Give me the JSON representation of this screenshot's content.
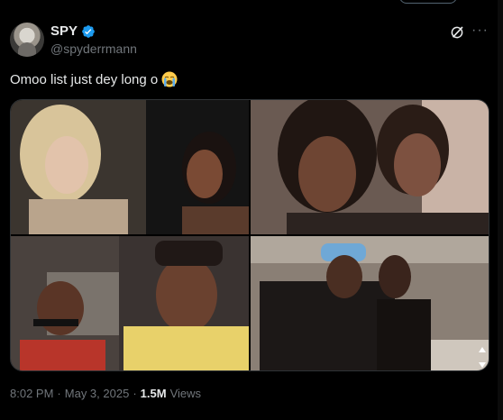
{
  "author": {
    "display_name": "SPY",
    "handle": "@spyderrmann",
    "verified_icon": "verified-badge-icon",
    "avatar_icon": "avatar-image"
  },
  "tweet": {
    "text": "Omoo list just dey long o",
    "emoji_icon": "loudly-crying-face-emoji"
  },
  "actions": {
    "grok_icon": "grok-icon",
    "more_icon": "more-options-icon"
  },
  "media": {
    "images": [
      "photo-1",
      "photo-2",
      "photo-3",
      "photo-4"
    ]
  },
  "meta": {
    "time": "8:02 PM",
    "separator": "·",
    "date": "May 3, 2025",
    "views_count": "1.5M",
    "views_label": "Views"
  },
  "colors": {
    "background": "#000000",
    "text": "#e7e9ea",
    "secondary": "#71767b",
    "verified": "#1d9bf0",
    "border": "#2f3336"
  }
}
